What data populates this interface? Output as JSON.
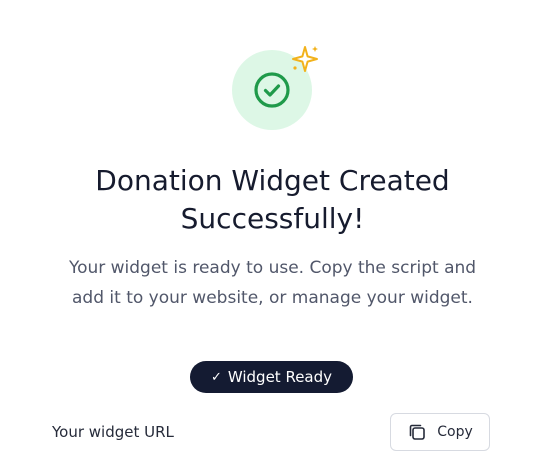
{
  "success": {
    "icon": "check-circle-icon",
    "decoration_icon": "sparkle-icon",
    "colors": {
      "circle_bg": "#ddf7e6",
      "check": "#1f9a4a",
      "sparkle": "#f2b21c"
    }
  },
  "title": "Donation Widget Created Successfully!",
  "description": "Your widget is ready to use. Copy the script and add it to your website, or manage your widget.",
  "badge": {
    "icon": "checkmark-icon",
    "label": "Widget Ready",
    "bg_color": "#141b32"
  },
  "url_section": {
    "label": "Your widget URL",
    "copy_button": {
      "icon": "copy-icon",
      "label": "Copy"
    }
  }
}
